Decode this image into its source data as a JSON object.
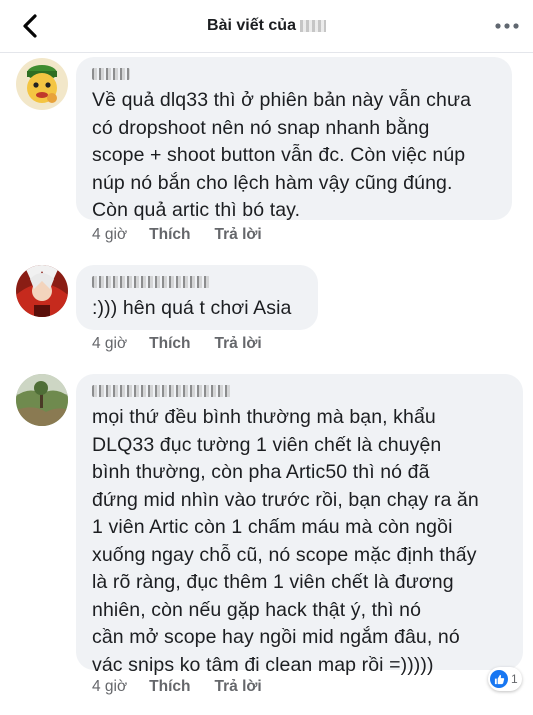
{
  "header": {
    "title": "Bài viết của"
  },
  "comments": [
    {
      "text": "Về quả dlq33 thì ở phiên bản này vẫn chưa\ncó dropshoot nên nó snap nhanh bằng\nscope + shoot button vẫn đc. Còn việc núp\nnúp nó bắn cho lệch hàm vậy cũng đúng.\nCòn quả artic thì bó tay.",
      "time": "4 giờ",
      "like_label": "Thích",
      "reply_label": "Trả lời"
    },
    {
      "text": ":))) hên quá t chơi Asia",
      "time": "4 giờ",
      "like_label": "Thích",
      "reply_label": "Trả lời"
    },
    {
      "text": "mọi thứ đều bình thường mà bạn, khẩu\nDLQ33 đục tường 1 viên chết là chuyện\nbình thường, còn pha Artic50 thì nó đã\nđứng mid nhìn vào trước rồi, bạn chạy ra ăn\n1 viên Artic còn 1 chấm máu mà còn ngồi\nxuống ngay chỗ cũ, nó scope mặc định thấy\nlà rõ ràng, đục thêm 1 viên chết là đương\nnhiên, còn nếu gặp hack thật ý, thì nó        \ncần mở scope hay ngồi mid ngắm đâu, nó\nvác snips ko tâm đi clean map rồi =)))))",
      "time": "4 giờ",
      "like_label": "Thích",
      "reply_label": "Trả lời",
      "reaction_count": "1"
    }
  ],
  "colors": {
    "bubble": "#f0f2f5",
    "meta_text": "#65676b",
    "like_blue": "#1877f2"
  }
}
